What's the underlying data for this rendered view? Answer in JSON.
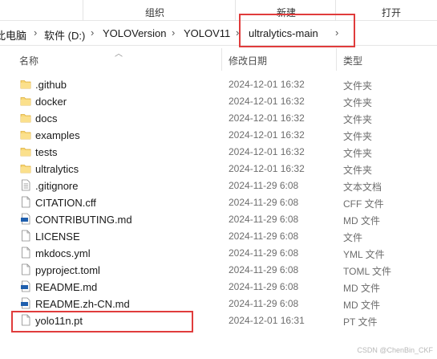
{
  "ribbon": {
    "groups": [
      "组织",
      "新建",
      "打开"
    ]
  },
  "breadcrumb": {
    "items": [
      "此电脑",
      "软件 (D:)",
      "YOLOVersion",
      "YOLOV11",
      "ultralytics-main"
    ],
    "separator": "›"
  },
  "columns": {
    "name": "名称",
    "date": "修改日期",
    "type": "类型"
  },
  "files": [
    {
      "name": ".github",
      "date": "2024-12-01 16:32",
      "type": "文件夹",
      "icon": "folder-icon"
    },
    {
      "name": "docker",
      "date": "2024-12-01 16:32",
      "type": "文件夹",
      "icon": "folder-icon"
    },
    {
      "name": "docs",
      "date": "2024-12-01 16:32",
      "type": "文件夹",
      "icon": "folder-icon"
    },
    {
      "name": "examples",
      "date": "2024-12-01 16:32",
      "type": "文件夹",
      "icon": "folder-icon"
    },
    {
      "name": "tests",
      "date": "2024-12-01 16:32",
      "type": "文件夹",
      "icon": "folder-icon"
    },
    {
      "name": "ultralytics",
      "date": "2024-12-01 16:32",
      "type": "文件夹",
      "icon": "folder-icon"
    },
    {
      "name": ".gitignore",
      "date": "2024-11-29 6:08",
      "type": "文本文档",
      "icon": "text-file-icon"
    },
    {
      "name": "CITATION.cff",
      "date": "2024-11-29 6:08",
      "type": "CFF 文件",
      "icon": "file-icon"
    },
    {
      "name": "CONTRIBUTING.md",
      "date": "2024-11-29 6:08",
      "type": "MD 文件",
      "icon": "markdown-file-icon"
    },
    {
      "name": "LICENSE",
      "date": "2024-11-29 6:08",
      "type": "文件",
      "icon": "file-icon"
    },
    {
      "name": "mkdocs.yml",
      "date": "2024-11-29 6:08",
      "type": "YML 文件",
      "icon": "file-icon"
    },
    {
      "name": "pyproject.toml",
      "date": "2024-11-29 6:08",
      "type": "TOML 文件",
      "icon": "file-icon"
    },
    {
      "name": "README.md",
      "date": "2024-11-29 6:08",
      "type": "MD 文件",
      "icon": "markdown-file-icon"
    },
    {
      "name": "README.zh-CN.md",
      "date": "2024-11-29 6:08",
      "type": "MD 文件",
      "icon": "markdown-file-icon"
    },
    {
      "name": "yolo11n.pt",
      "date": "2024-12-01 16:31",
      "type": "PT 文件",
      "icon": "file-icon"
    }
  ],
  "watermark": "CSDN @ChenBin_CKF",
  "colors": {
    "highlight": "#e03c3c",
    "folder": "#f8d775",
    "md_badge": "#1f5fae"
  }
}
